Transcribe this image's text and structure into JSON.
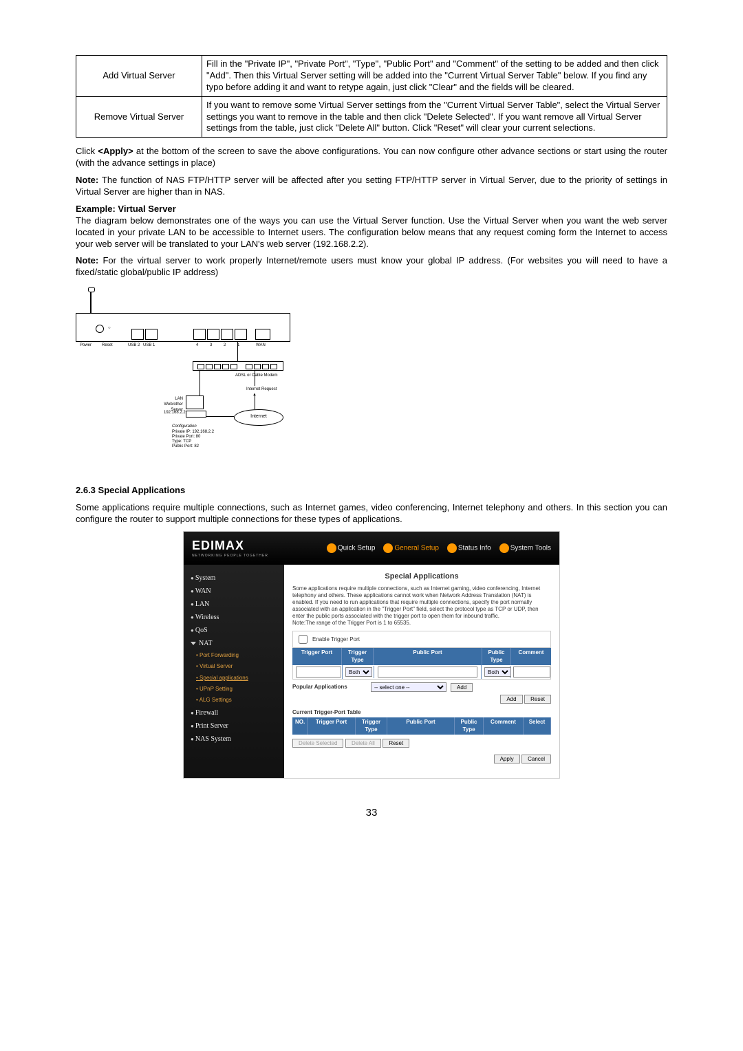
{
  "paramTable": {
    "rows": [
      {
        "label": "Add Virtual Server",
        "desc": "Fill in the \"Private IP\", \"Private Port\", \"Type\", \"Public Port\" and \"Comment\" of the setting to be added and then click \"Add\". Then this Virtual Server setting will be added into the \"Current Virtual Server Table\" below. If you find any typo before adding it and want to retype again, just click \"Clear\" and the fields will be cleared."
      },
      {
        "label": "Remove Virtual Server",
        "desc": "If you want to remove some Virtual Server settings from the \"Current Virtual Server Table\", select the Virtual Server settings you want to remove in the table and then click \"Delete Selected\". If you want remove all Virtual Server settings from the table, just click \"Delete All\" button. Click \"Reset\" will clear your current selections."
      }
    ]
  },
  "body": {
    "p1a": "Click ",
    "p1b": "<Apply>",
    "p1c": " at the bottom of the screen to save the above configurations. You can now configure other advance sections or start using the router (with the advance settings in place)",
    "note1a": "Note:",
    "note1b": " The function of NAS FTP/HTTP server will be affected after you setting FTP/HTTP server in Virtual Server, due to the priority of settings in Virtual Server are higher than in NAS.",
    "exTitle": "Example: Virtual Server",
    "exBody": "The diagram below demonstrates one of the ways you can use the Virtual Server function. Use the Virtual Server when you want the web server located in your private LAN to be accessible to Internet users. The configuration below means that any request coming form the Internet to access your web server will be translated to your LAN's web server (192.168.2.2).",
    "note2a": "Note:",
    "note2b": " For the virtual server to work properly Internet/remote users must know your global IP address. (For websites you will need to have a fixed/static global/public IP address)"
  },
  "diagram": {
    "adsl": "ADSL or Cable Modem",
    "request": "Internet Request",
    "serverLabel": "LAN Web/other Server",
    "serverIp": "192.168.2.2",
    "cloud": "Internet",
    "conf1": "Configuration",
    "conf2": "Private IP: 192.168.2.2",
    "conf3": "Private Port: 80",
    "conf4": "Type: TCP",
    "conf5": "Public Port: 82",
    "portPower": "Power",
    "portReset": "Reset",
    "portUsb2": "USB 2",
    "portUsb1": "USB 1",
    "p4": "4",
    "p3": "3",
    "p2": "2",
    "p1": "1",
    "wan": "WAN"
  },
  "section": {
    "num": "2.6.3 Special Applications",
    "text": "Some applications require multiple connections, such as Internet games, video conferencing, Internet telephony and others. In this section you can configure the router to support multiple connections for these types of applications."
  },
  "shot": {
    "brand": "EDIMAX",
    "brandSub": "NETWORKING PEOPLE TOGETHER",
    "nav": {
      "quick": "Quick Setup",
      "general": "General Setup",
      "status": "Status Info",
      "tools": "System Tools"
    },
    "side": {
      "system": "System",
      "wan": "WAN",
      "lan": "LAN",
      "wireless": "Wireless",
      "qos": "QoS",
      "nat": "NAT",
      "portfw": "Port Forwarding",
      "vserver": "Virtual Server",
      "spapp": "Special applications",
      "upnp": "UPnP Setting",
      "alg": "ALG Settings",
      "firewall": "Firewall",
      "print": "Print Server",
      "nas": "NAS System"
    },
    "title": "Special Applications",
    "desc": "Some applications require multiple connections, such as Internet gaming, video conferencing, Internet telephony and others. These applications cannot work when Network Address Translation (NAT) is enabled. If you need to run applications that require multiple connections, specify the port normally associated with an application in the \"Trigger Port\" field, select the protocol type as TCP or UDP, then enter the public ports associated with the trigger port to open them for inbound traffic.",
    "descNote": "Note:The range of the Trigger Port is 1 to 65535.",
    "enable": "Enable Trigger Port",
    "hdr": {
      "tp": "Trigger Port",
      "tt": "Trigger Type",
      "pp": "Public Port",
      "pt": "Public Type",
      "cm": "Comment"
    },
    "both": "Both",
    "popular": "Popular Applications",
    "selone": "-- select one --",
    "add": "Add",
    "addBtn": "Add",
    "resetBtn": "Reset",
    "tableTitle": "Current Trigger-Port Table",
    "hdr2": {
      "no": "NO.",
      "tp": "Trigger Port",
      "tt": "Trigger Type",
      "pp": "Public Port",
      "pt": "Public Type",
      "cm": "Comment",
      "sel": "Select"
    },
    "delSel": "Delete Selected",
    "delAll": "Delete All",
    "reset2": "Reset",
    "apply": "Apply",
    "cancel": "Cancel"
  },
  "pageNumber": "33"
}
